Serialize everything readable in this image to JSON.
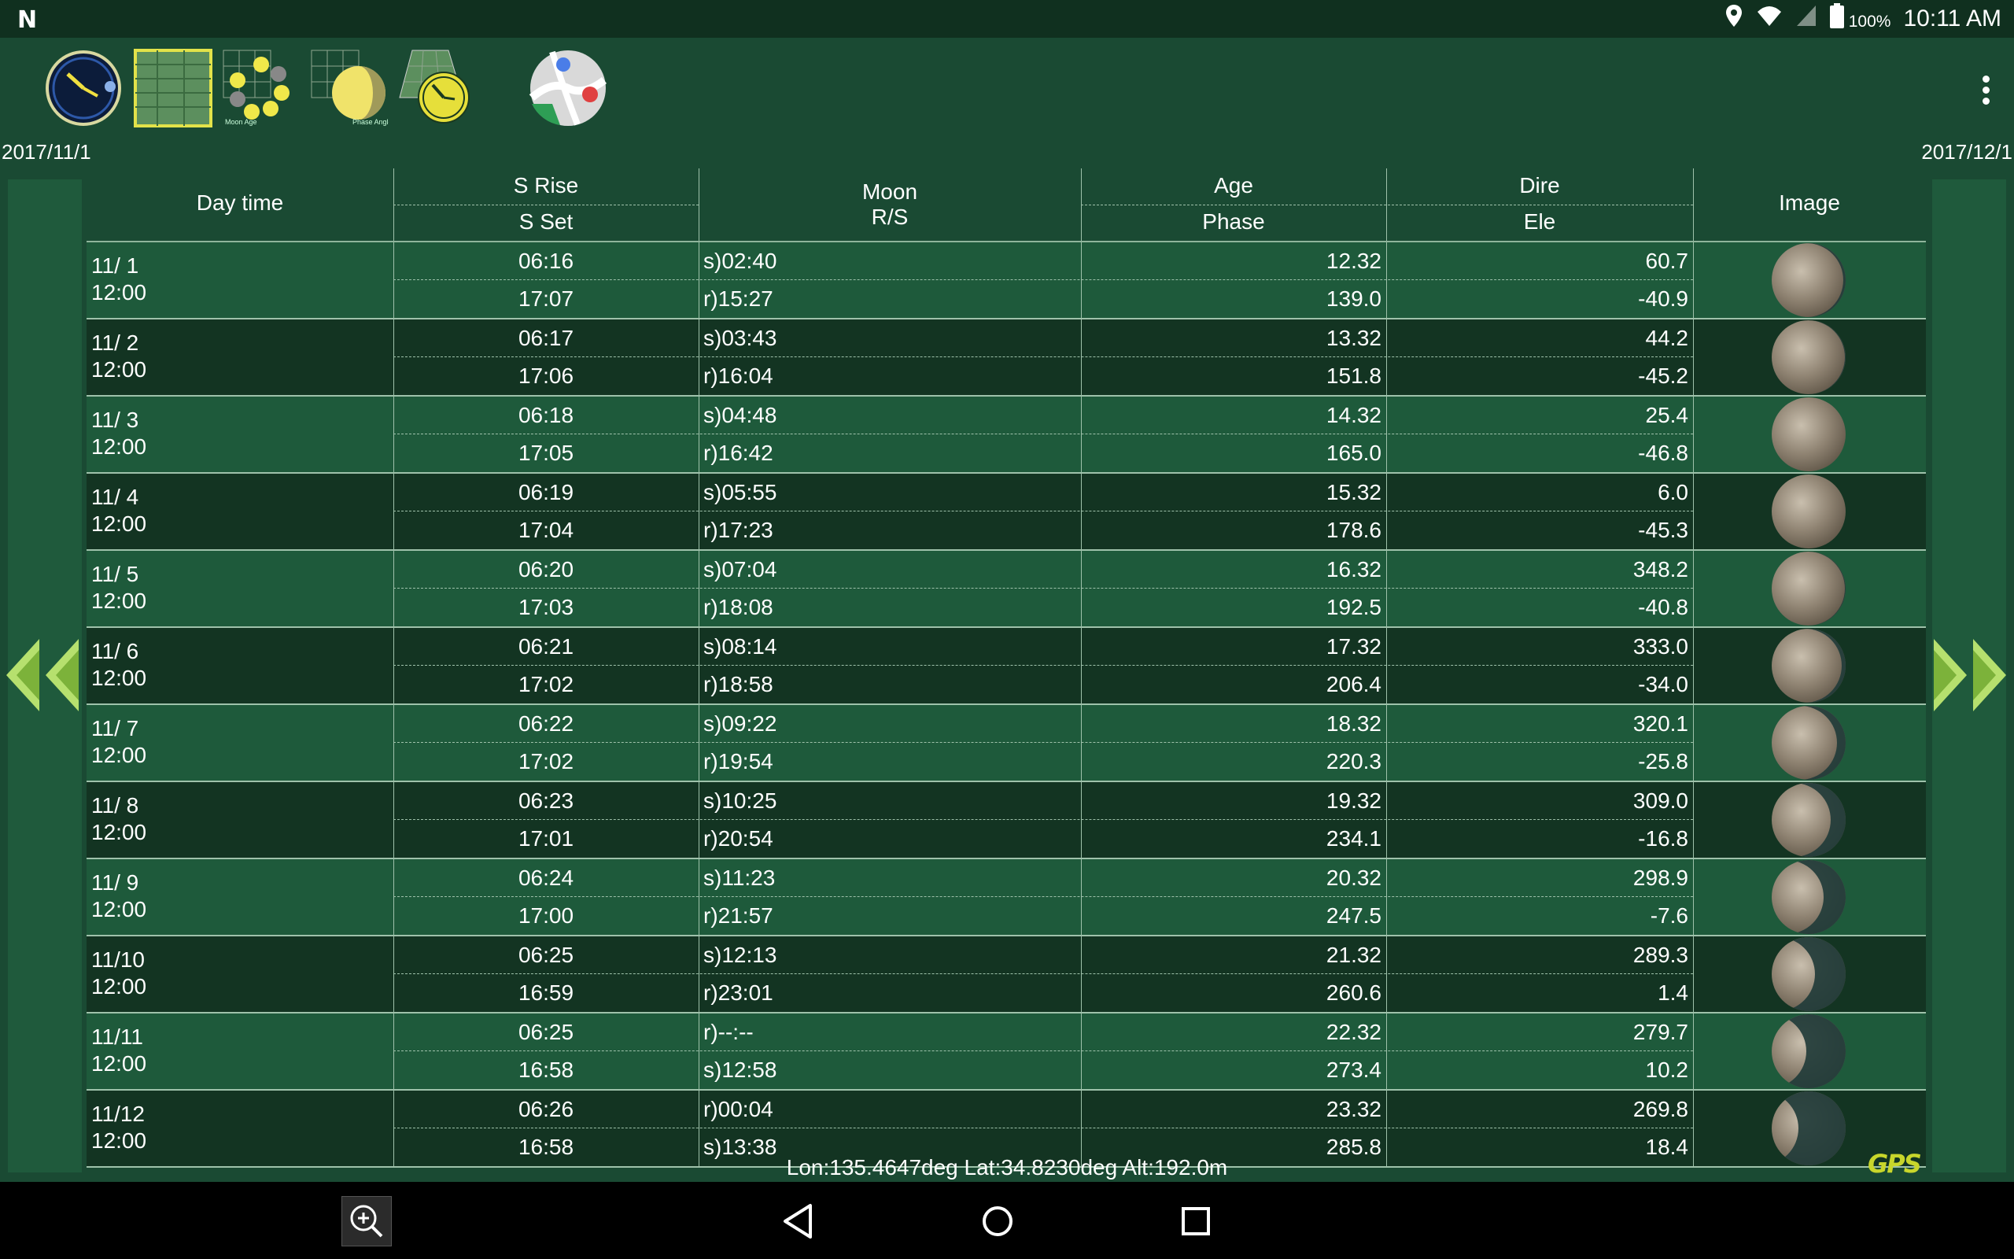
{
  "status": {
    "time": "10:11 AM",
    "battery": "100%"
  },
  "dates": {
    "start": "2017/11/1",
    "end": "2017/12/1"
  },
  "header": {
    "daytime": "Day time",
    "srise": "S Rise",
    "sset": "S Set",
    "moon": "Moon",
    "rs": "R/S",
    "age": "Age",
    "phase": "Phase",
    "dire": "Dire",
    "ele": "Ele",
    "image": "Image"
  },
  "rows": [
    {
      "date": "11/ 1",
      "time": "12:00",
      "rise": "06:16",
      "set": "17:07",
      "moon1": "s)02:40",
      "moon2": "r)15:27",
      "age": "12.32",
      "phase": "139.0",
      "dire": "60.7",
      "ele": "-40.9",
      "illum": 0.97
    },
    {
      "date": "11/ 2",
      "time": "12:00",
      "rise": "06:17",
      "set": "17:06",
      "moon1": "s)03:43",
      "moon2": "r)16:04",
      "age": "13.32",
      "phase": "151.8",
      "dire": "44.2",
      "ele": "-45.2",
      "illum": 0.99
    },
    {
      "date": "11/ 3",
      "time": "12:00",
      "rise": "06:18",
      "set": "17:05",
      "moon1": "s)04:48",
      "moon2": "r)16:42",
      "age": "14.32",
      "phase": "165.0",
      "dire": "25.4",
      "ele": "-46.8",
      "illum": 1.0
    },
    {
      "date": "11/ 4",
      "time": "12:00",
      "rise": "06:19",
      "set": "17:04",
      "moon1": "s)05:55",
      "moon2": "r)17:23",
      "age": "15.32",
      "phase": "178.6",
      "dire": "6.0",
      "ele": "-45.3",
      "illum": 1.0
    },
    {
      "date": "11/ 5",
      "time": "12:00",
      "rise": "06:20",
      "set": "17:03",
      "moon1": "s)07:04",
      "moon2": "r)18:08",
      "age": "16.32",
      "phase": "192.5",
      "dire": "348.2",
      "ele": "-40.8",
      "illum": 0.99
    },
    {
      "date": "11/ 6",
      "time": "12:00",
      "rise": "06:21",
      "set": "17:02",
      "moon1": "s)08:14",
      "moon2": "r)18:58",
      "age": "17.32",
      "phase": "206.4",
      "dire": "333.0",
      "ele": "-34.0",
      "illum": 0.95
    },
    {
      "date": "11/ 7",
      "time": "12:00",
      "rise": "06:22",
      "set": "17:02",
      "moon1": "s)09:22",
      "moon2": "r)19:54",
      "age": "18.32",
      "phase": "220.3",
      "dire": "320.1",
      "ele": "-25.8",
      "illum": 0.88
    },
    {
      "date": "11/ 8",
      "time": "12:00",
      "rise": "06:23",
      "set": "17:01",
      "moon1": "s)10:25",
      "moon2": "r)20:54",
      "age": "19.32",
      "phase": "234.1",
      "dire": "309.0",
      "ele": "-16.8",
      "illum": 0.8
    },
    {
      "date": "11/ 9",
      "time": "12:00",
      "rise": "06:24",
      "set": "17:00",
      "moon1": "s)11:23",
      "moon2": "r)21:57",
      "age": "20.32",
      "phase": "247.5",
      "dire": "298.9",
      "ele": "-7.6",
      "illum": 0.7
    },
    {
      "date": "11/10",
      "time": "12:00",
      "rise": "06:25",
      "set": "16:59",
      "moon1": "s)12:13",
      "moon2": "r)23:01",
      "age": "21.32",
      "phase": "260.6",
      "dire": "289.3",
      "ele": "1.4",
      "illum": 0.58
    },
    {
      "date": "11/11",
      "time": "12:00",
      "rise": "06:25",
      "set": "16:58",
      "moon1": "r)--:--",
      "moon2": "s)12:58",
      "age": "22.32",
      "phase": "273.4",
      "dire": "279.7",
      "ele": "10.2",
      "illum": 0.47
    },
    {
      "date": "11/12",
      "time": "12:00",
      "rise": "06:26",
      "set": "16:58",
      "moon1": "r)00:04",
      "moon2": "s)13:38",
      "age": "23.32",
      "phase": "285.8",
      "dire": "269.8",
      "ele": "18.4",
      "illum": 0.36
    }
  ],
  "location": "Lon:135.4647deg Lat:34.8230deg Alt:192.0m",
  "gps_label": "GPS",
  "colors": {
    "bg": "#1a4a33",
    "row_odd": "#1e5a3b",
    "row_even": "#133422",
    "accent": "#c8d62b"
  }
}
